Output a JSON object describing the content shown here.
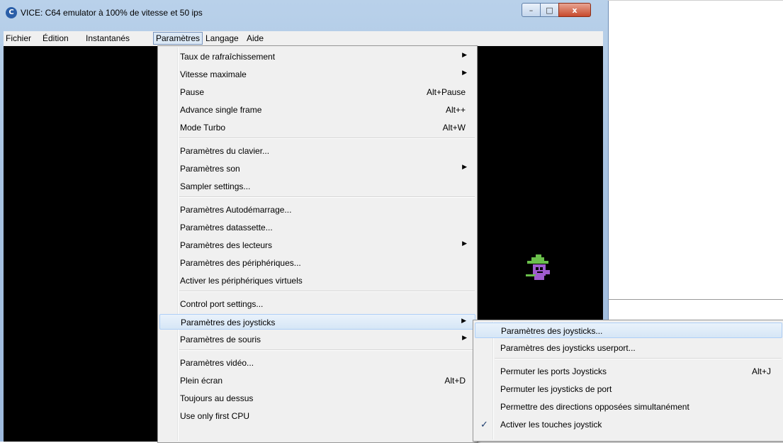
{
  "window": {
    "title": "VICE: C64 emulator à 100% de vitesse et 50 ips",
    "icon": "vice-app-icon",
    "controls": {
      "minimize": "–",
      "maximize": "□",
      "close": "x"
    }
  },
  "menubar": [
    "Fichier",
    "Édition",
    "Instantanés",
    "Paramètres",
    "Langage",
    "Aide"
  ],
  "menu": {
    "items": [
      {
        "label": "Taux de rafraîchissement",
        "shortcut": "",
        "submenu": true
      },
      {
        "label": "Vitesse maximale",
        "shortcut": "",
        "submenu": true
      },
      {
        "label": "Pause",
        "shortcut": "Alt+Pause",
        "submenu": false
      },
      {
        "label": "Advance single frame",
        "shortcut": "Alt++",
        "submenu": false
      },
      {
        "label": "Mode Turbo",
        "shortcut": "Alt+W",
        "submenu": false
      },
      {
        "label": "Paramètres du clavier...",
        "shortcut": "",
        "submenu": false
      },
      {
        "label": "Paramètres son",
        "shortcut": "",
        "submenu": true
      },
      {
        "label": "Sampler settings...",
        "shortcut": "",
        "submenu": false
      },
      {
        "label": "Paramètres Autodémarrage...",
        "shortcut": "",
        "submenu": false
      },
      {
        "label": "Paramètres datassette...",
        "shortcut": "",
        "submenu": false
      },
      {
        "label": "Paramètres des lecteurs",
        "shortcut": "",
        "submenu": true
      },
      {
        "label": "Paramètres des périphériques...",
        "shortcut": "",
        "submenu": false
      },
      {
        "label": "Activer les périphériques virtuels",
        "shortcut": "",
        "submenu": false
      },
      {
        "label": "Control port settings...",
        "shortcut": "",
        "submenu": false
      },
      {
        "label": "Paramètres des joysticks",
        "shortcut": "",
        "submenu": true,
        "highlighted": true
      },
      {
        "label": "Paramètres de souris",
        "shortcut": "",
        "submenu": true
      },
      {
        "label": "Paramètres vidéo...",
        "shortcut": "",
        "submenu": false
      },
      {
        "label": "Plein écran",
        "shortcut": "Alt+D",
        "submenu": false
      },
      {
        "label": "Toujours au dessus",
        "shortcut": "",
        "submenu": false
      },
      {
        "label": "Use only first CPU",
        "shortcut": "",
        "submenu": false
      }
    ]
  },
  "submenu": {
    "items": [
      {
        "label": "Paramètres des joysticks...",
        "shortcut": "",
        "highlighted": true,
        "checked": false
      },
      {
        "label": "Paramètres des joysticks userport...",
        "shortcut": "",
        "checked": false
      },
      {
        "label": "Permuter les ports Joysticks",
        "shortcut": "Alt+J",
        "checked": false
      },
      {
        "label": "Permuter les joysticks de port",
        "shortcut": "",
        "checked": false
      },
      {
        "label": "Permettre des directions opposées simultanément",
        "shortcut": "",
        "checked": false
      },
      {
        "label": "Activer les touches joystick",
        "shortcut": "",
        "checked": true
      }
    ]
  },
  "checkmark": "✓",
  "arrow": "▶",
  "colors": {
    "screen": "#000000",
    "highlight": "#d6e6f6",
    "sprite_hat": "#6abf4b",
    "sprite_body": "#a05ccf"
  }
}
